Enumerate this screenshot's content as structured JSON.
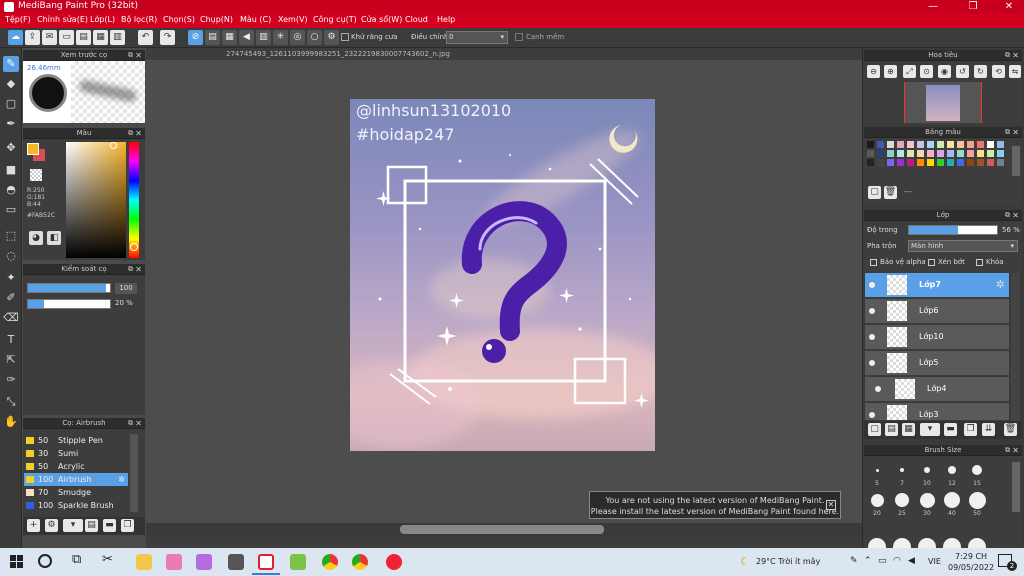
{
  "window": {
    "title": "MediBang Paint Pro (32bit)"
  },
  "menu": [
    "Tệp(F)",
    "Chỉnh sửa(E)",
    "Lớp(L)",
    "Bộ lọc(R)",
    "Chọn(S)",
    "Chụp(N)",
    "Màu (C)",
    "Xem(V)",
    "Công cụ(T)",
    "Cửa sổ(W)",
    "Cloud",
    "Help"
  ],
  "toolbar": {
    "antialias_label": "Khử răng cưa",
    "adjust_label": "Điều chỉnh",
    "adjust_value": "0",
    "edge_label": "Cạnh mềm"
  },
  "canvas": {
    "tab_title": "274745493_1261103999983251_2322219830007743602_n.jpg"
  },
  "artwork": {
    "watermark_line1": "@linhsun13102010",
    "watermark_line2": "#hoidap247"
  },
  "panels": {
    "brush_preview": {
      "title": "Xem trước cọ",
      "size_label": "26.46mm"
    },
    "color": {
      "title": "Màu",
      "r": "R:250",
      "g": "G:181",
      "b": "B:44",
      "hex": "#FAB52C",
      "current_color": "#FAB52C",
      "secondary_color": "#d94f4f"
    },
    "brush_control": {
      "title": "Kiểm soát cọ",
      "size_value": "100",
      "opacity_value": "20 %",
      "size_fraction": 0.95,
      "opacity_fraction": 0.2
    },
    "brush_list": {
      "title": "Cọ: Airbrush",
      "items": [
        {
          "size": "50",
          "name": "Stipple Pen",
          "color": "#f0d020"
        },
        {
          "size": "30",
          "name": "Sumi",
          "color": "#f0d020"
        },
        {
          "size": "50",
          "name": "Acrylic",
          "color": "#f0d020"
        },
        {
          "size": "100",
          "name": "Airbrush",
          "color": "#f0d020"
        },
        {
          "size": "70",
          "name": "Smudge",
          "color": "#f2e0c8"
        },
        {
          "size": "100",
          "name": "Sparkle Brush",
          "color": "#3060e0"
        }
      ]
    },
    "navigator": {
      "title": "Hoa tiêu"
    },
    "palette": {
      "title": "Bảng màu",
      "footer": "---"
    },
    "layers": {
      "title": "Lớp",
      "opacity_label": "Độ trong",
      "opacity_value": "56 %",
      "opacity_fraction": 0.56,
      "blend_label": "Pha trộn",
      "blend_value": "Màn hình",
      "protect_alpha": "Bảo vệ alpha",
      "clipping": "Xén bớt",
      "lock": "Khóa",
      "items": [
        {
          "name": "Lớp7",
          "selected": true
        },
        {
          "name": "Lớp6",
          "selected": false
        },
        {
          "name": "Lớp10",
          "selected": false
        },
        {
          "name": "Lớp5",
          "selected": false
        },
        {
          "name": "Lớp4",
          "selected": false
        },
        {
          "name": "Lớp3",
          "selected": false
        }
      ]
    },
    "brush_size": {
      "title": "Brush Size",
      "sizes": [
        "5",
        "7",
        "10",
        "12",
        "15",
        "20",
        "25",
        "30",
        "40",
        "50"
      ]
    }
  },
  "notification": {
    "line1": "You are not using the latest version of MediBang Paint.",
    "line2": "Please install the latest version of MediBang Paint found here."
  },
  "taskbar": {
    "weather": "29°C  Trời ít mây",
    "language": "VIE",
    "time": "7:29 CH",
    "date": "09/05/2022",
    "notifications": "2"
  }
}
